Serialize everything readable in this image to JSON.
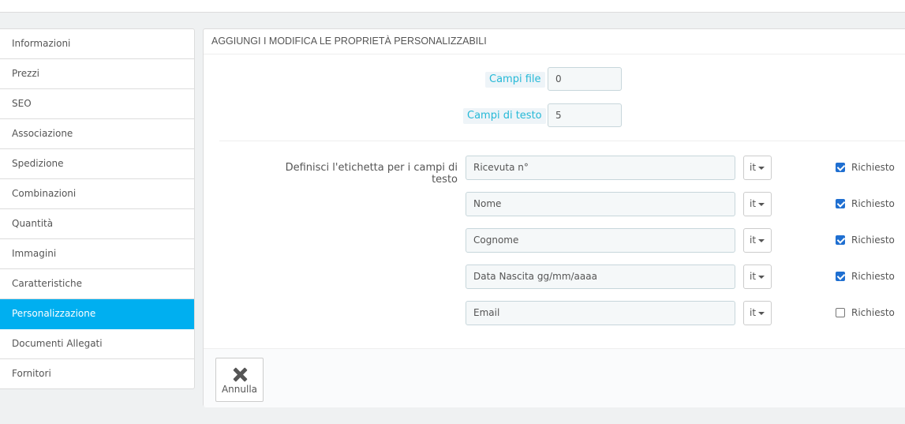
{
  "sidebar": {
    "items": [
      {
        "label": "Informazioni"
      },
      {
        "label": "Prezzi"
      },
      {
        "label": "SEO"
      },
      {
        "label": "Associazione"
      },
      {
        "label": "Spedizione"
      },
      {
        "label": "Combinazioni"
      },
      {
        "label": "Quantità"
      },
      {
        "label": "Immagini"
      },
      {
        "label": "Caratteristiche"
      },
      {
        "label": "Personalizzazione",
        "active": true
      },
      {
        "label": "Documenti Allegati"
      },
      {
        "label": "Fornitori"
      }
    ],
    "active_color": "#00aff0"
  },
  "panel": {
    "heading": "AGGIUNGI I MODIFICA LE PROPRIETÀ PERSONALIZZABILI",
    "file_fields": {
      "label": "Campi file",
      "value": "0"
    },
    "text_fields": {
      "label": "Campi di testo",
      "value": "5"
    },
    "define_label": "Definisci l'etichetta per i campi di testo",
    "rows": [
      {
        "value": "Ricevuta n°",
        "lang": "it",
        "required_label": "Richiesto",
        "required": true
      },
      {
        "value": "Nome",
        "lang": "it",
        "required_label": "Richiesto",
        "required": true
      },
      {
        "value": "Cognome",
        "lang": "it",
        "required_label": "Richiesto",
        "required": true
      },
      {
        "value": "Data Nascita gg/mm/aaaa",
        "lang": "it",
        "required_label": "Richiesto",
        "required": true
      },
      {
        "value": "Email",
        "lang": "it",
        "required_label": "Richiesto",
        "required": false
      }
    ],
    "cancel_label": "Annulla",
    "cancel_icon": "close-icon"
  }
}
